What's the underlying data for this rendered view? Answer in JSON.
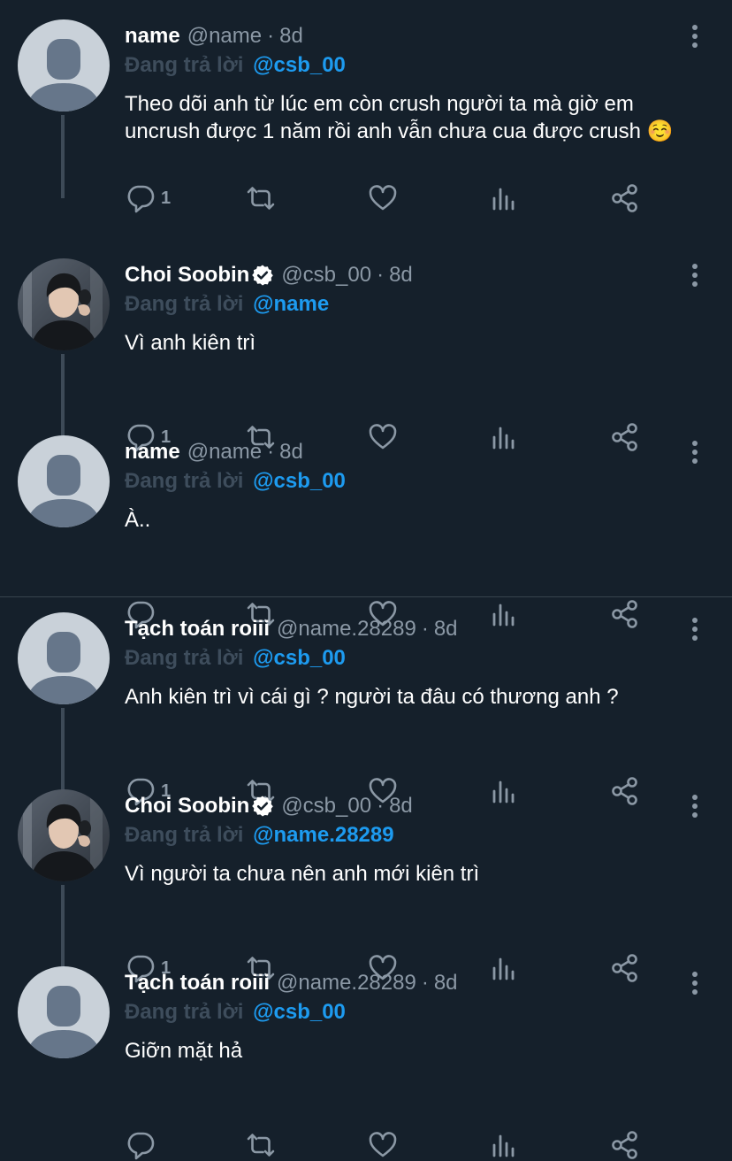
{
  "colors": {
    "background": "#15202b",
    "accent": "#1d9bf0",
    "muted": "#8b98a5",
    "thread_line": "#3d4a57"
  },
  "tweets": [
    {
      "avatar": "default-avatar",
      "name": "name",
      "verified": false,
      "handle": "@name",
      "dot": "·",
      "time": "8d",
      "replying_label": "Đang trả lời",
      "replying_to": "@csb_00",
      "content": "Theo dõi anh từ lúc em còn crush người ta mà giờ em uncrush được 1 năm rồi anh vẫn chưa cua được crush ☺️",
      "reply_count": "1",
      "thread_below": true
    },
    {
      "avatar": "profile-photo",
      "name": "Choi Soobin",
      "verified": true,
      "handle": "@csb_00",
      "dot": "·",
      "time": "8d",
      "replying_label": "Đang trả lời",
      "replying_to": "@name",
      "content": "Vì anh kiên trì",
      "reply_count": "1",
      "thread_below": true
    },
    {
      "avatar": "default-avatar",
      "name": "name",
      "verified": false,
      "handle": "@name",
      "dot": "·",
      "time": "8d",
      "replying_label": "Đang trả lời",
      "replying_to": "@csb_00",
      "content": "À..",
      "reply_count": "",
      "thread_below": false
    },
    {
      "avatar": "default-avatar",
      "name": "Tạch toán roiii",
      "verified": false,
      "handle": "@name.28289",
      "dot": "·",
      "time": "8d",
      "replying_label": "Đang trả lời",
      "replying_to": "@csb_00",
      "content": "Anh kiên trì vì cái gì ? người ta đâu có thương anh ?",
      "reply_count": "1",
      "thread_below": true
    },
    {
      "avatar": "profile-photo",
      "name": "Choi Soobin",
      "verified": true,
      "handle": "@csb_00",
      "dot": "·",
      "time": "8d",
      "replying_label": "Đang trả lời",
      "replying_to": "@name.28289",
      "content": "Vì người ta chưa nên anh mới kiên trì",
      "reply_count": "1",
      "thread_below": true
    },
    {
      "avatar": "default-avatar",
      "name": "Tạch toán roiii",
      "verified": false,
      "handle": "@name.28289",
      "dot": "·",
      "time": "8d",
      "replying_label": "Đang trả lời",
      "replying_to": "@csb_00",
      "content": "Giỡn mặt hả",
      "reply_count": "",
      "thread_below": false
    }
  ]
}
